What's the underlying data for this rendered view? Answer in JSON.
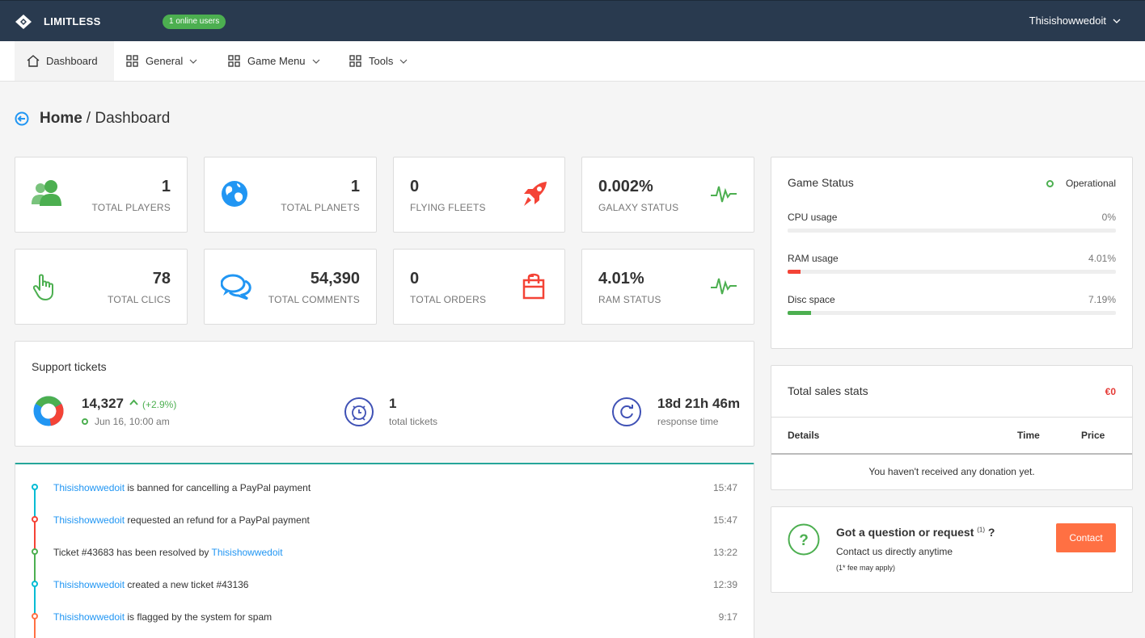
{
  "topbar": {
    "brand": "LIMITLESS",
    "online_badge": "1 online users",
    "username": "Thisishowwedoit"
  },
  "nav": [
    {
      "label": "Dashboard",
      "icon": "home-icon",
      "active": true
    },
    {
      "label": "General",
      "icon": "grid-icon"
    },
    {
      "label": "Game Menu",
      "icon": "grid-icon"
    },
    {
      "label": "Tools",
      "icon": "grid-icon"
    }
  ],
  "breadcrumb": {
    "home": "Home",
    "sep": "/ ",
    "current": "Dashboard"
  },
  "stats": [
    {
      "value": "1",
      "label": "TOTAL PLAYERS",
      "icon": "users-icon",
      "color": "#4caf50"
    },
    {
      "value": "1",
      "label": "TOTAL PLANETS",
      "icon": "globe-icon",
      "color": "#2196f3"
    },
    {
      "value": "0",
      "label": "FLYING FLEETS",
      "icon": "rocket-icon",
      "color": "#f44336"
    },
    {
      "value": "0.002%",
      "label": "GALAXY STATUS",
      "icon": "pulse-icon",
      "color": "#4caf50"
    },
    {
      "value": "78",
      "label": "TOTAL CLICS",
      "icon": "pointer-icon",
      "color": "#4caf50"
    },
    {
      "value": "54,390",
      "label": "TOTAL COMMENTS",
      "icon": "comments-icon",
      "color": "#2196f3"
    },
    {
      "value": "0",
      "label": "TOTAL ORDERS",
      "icon": "shopping-bag-icon",
      "color": "#f44336"
    },
    {
      "value": "4.01%",
      "label": "RAM STATUS",
      "icon": "pulse-icon",
      "color": "#4caf50"
    }
  ],
  "support": {
    "title": "Support tickets",
    "count": "14,327",
    "change": "(+2.9%)",
    "date": "Jun 16, 10:00 am",
    "tickets_value": "1",
    "tickets_label": "total tickets",
    "response_value": "18d 21h 46m",
    "response_label": "response time"
  },
  "timeline": [
    {
      "user": "Thisishowwedoit",
      "text": " is banned for cancelling a PayPal payment",
      "time": "15:47",
      "color": "#00bcd4"
    },
    {
      "user": "Thisishowwedoit",
      "text": " requested an refund for a PayPal payment",
      "time": "15:47",
      "color": "#f44336"
    },
    {
      "pre": "Ticket ",
      "ticket": "#43683",
      "text": " has been resolved by ",
      "user": "Thisishowwedoit",
      "time": "13:22",
      "color": "#4caf50"
    },
    {
      "user": "Thisishowwedoit",
      "text": " created a new ticket ",
      "ticket": "#43136",
      "time": "12:39",
      "color": "#00bcd4"
    },
    {
      "user": "Thisishowwedoit",
      "text": " is flagged by the system for ",
      "bold": "spam",
      "time": "9:17",
      "color": "#ff7043"
    }
  ],
  "game_status": {
    "title": "Game Status",
    "status": "Operational",
    "rows": [
      {
        "label": "CPU usage",
        "value": "0%",
        "percent": 0,
        "color": "#4caf50"
      },
      {
        "label": "RAM usage",
        "value": "4.01%",
        "percent": 4.01,
        "color": "#f44336"
      },
      {
        "label": "Disc space",
        "value": "7.19%",
        "percent": 7.19,
        "color": "#4caf50"
      }
    ]
  },
  "sales": {
    "title": "Total sales stats",
    "total": "€0",
    "col_details": "Details",
    "col_time": "Time",
    "col_price": "Price",
    "empty": "You haven't received any donation yet."
  },
  "contact": {
    "title": "Got a question or request",
    "sup": "(1)",
    "q": " ?",
    "sub": "Contact us directly anytime",
    "note": "(1* fee may apply)",
    "button": "Contact"
  }
}
